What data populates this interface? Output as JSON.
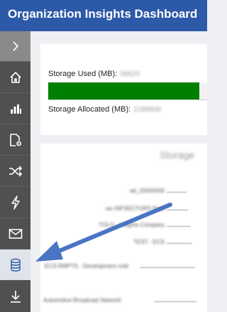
{
  "header": {
    "title": "Organization Insights Dashboard"
  },
  "sidebar": {
    "items": [
      {
        "name": "expand",
        "icon": "chevron-right-icon"
      },
      {
        "name": "home",
        "icon": "home-icon"
      },
      {
        "name": "analytics",
        "icon": "bar-chart-icon"
      },
      {
        "name": "reports",
        "icon": "document-gear-icon"
      },
      {
        "name": "shuffle",
        "icon": "shuffle-icon"
      },
      {
        "name": "activity",
        "icon": "lightning-icon"
      },
      {
        "name": "email",
        "icon": "envelope-icon"
      },
      {
        "name": "storage",
        "icon": "database-icon",
        "active": true
      },
      {
        "name": "download",
        "icon": "download-icon"
      }
    ]
  },
  "storage": {
    "used_label": "Storage Used (MB):",
    "used_value": "58620",
    "allocated_label": "Storage Allocated (MB):",
    "allocated_value": "2188800",
    "bar_fill_fraction": 0.95,
    "bar_color": "#008000"
  },
  "chart": {
    "title": "Storage",
    "labels": [
      "ad_20000000",
      "wo INFSECTORS Prod",
      "TOLO - Insights Company",
      "TEST - ECS",
      "ECS RMPTS - Development vold",
      "Automotive Broadcast Network"
    ]
  },
  "colors": {
    "header": "#2d5aa8",
    "sidebar": "#505050",
    "active": "#dfe3ea",
    "annotation_arrow": "#4a75c4"
  }
}
